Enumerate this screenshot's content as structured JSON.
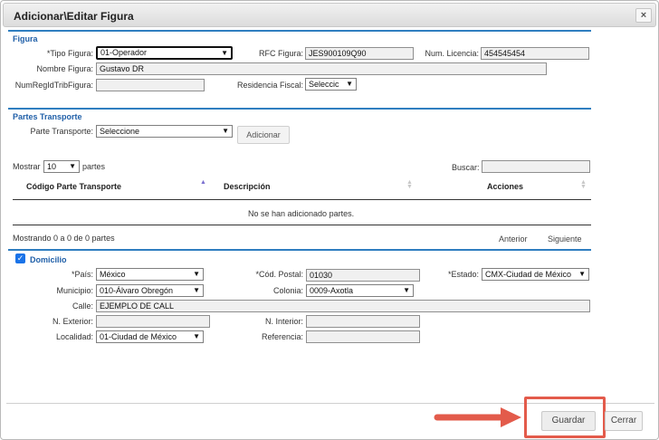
{
  "dialog": {
    "title": "Adicionar\\Editar Figura",
    "close_glyph": "×"
  },
  "figura": {
    "section_title": "Figura",
    "tipo_label": "*Tipo Figura:",
    "tipo_value": "01-Operador",
    "rfc_label": "RFC Figura:",
    "rfc_value": "JES900109Q90",
    "licencia_label": "Num. Licencia:",
    "licencia_value": "454545454",
    "nombre_label": "Nombre Figura:",
    "nombre_value": "Gustavo DR",
    "numreg_label": "NumRegIdTribFigura:",
    "numreg_value": "",
    "residencia_label": "Residencia Fiscal:",
    "residencia_value": "Seleccic"
  },
  "partes": {
    "section_title": "Partes Transporte",
    "parte_label": "Parte Transporte:",
    "parte_value": "Seleccione",
    "add_button": "Adicionar",
    "mostrar_label": "Mostrar",
    "mostrar_value": "10",
    "partes_label": "partes",
    "buscar_label": "Buscar:",
    "buscar_value": "",
    "columns": [
      "Código Parte Transporte",
      "Descripción",
      "Acciones"
    ],
    "empty_message": "No se han adicionado partes.",
    "info": "Mostrando 0 a 0 de 0 partes",
    "prev": "Anterior",
    "next": "Siguiente"
  },
  "domicilio": {
    "section_title": "Domicilio",
    "checked": true,
    "check_glyph": "✓",
    "pais_label": "*País:",
    "pais_value": "México",
    "cp_label": "*Cód. Postal:",
    "cp_value": "01030",
    "estado_label": "*Estado:",
    "estado_value": "CMX-Ciudad de México",
    "municipio_label": "Municipio:",
    "municipio_value": "010-Álvaro Obregón",
    "colonia_label": "Colonia:",
    "colonia_value": "0009-Axotla",
    "calle_label": "Calle:",
    "calle_value": "EJEMPLO DE CALL",
    "exterior_label": "N. Exterior:",
    "exterior_value": "",
    "interior_label": "N. Interior:",
    "interior_value": "",
    "localidad_label": "Localidad:",
    "localidad_value": "01-Ciudad de México",
    "referencia_label": "Referencia:",
    "referencia_value": ""
  },
  "footer": {
    "save": "Guardar",
    "cancel": "Cerrar"
  },
  "icons": {
    "dropdown": "chevron-down-icon",
    "sort": "sort-icon",
    "annotation_arrow": "arrow-right-icon"
  },
  "colors": {
    "section_title": "#1f5fa8",
    "section_bar": "#2f7ec0",
    "highlight": "#e35b4b",
    "checkbox": "#1a73e8",
    "sort_active": "#7a6fd0"
  }
}
